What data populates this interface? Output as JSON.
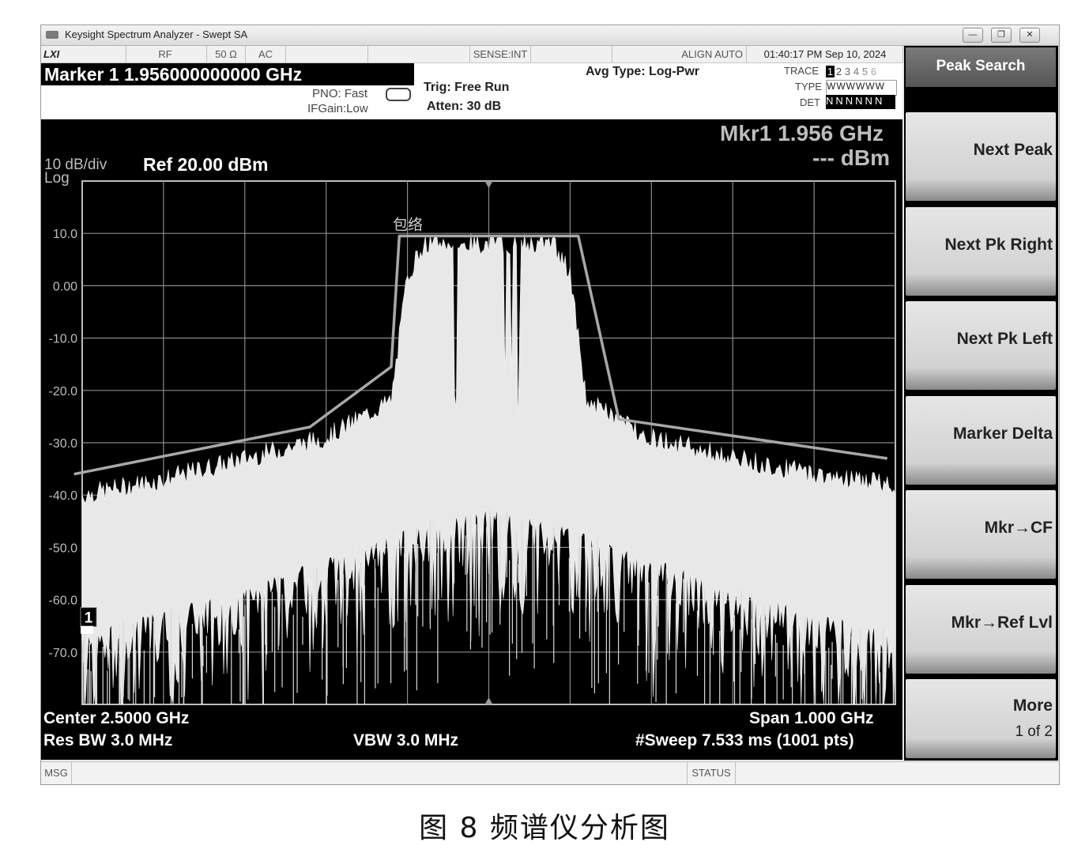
{
  "window": {
    "title": "Keysight Spectrum Analyzer - Swept SA"
  },
  "status_row": {
    "lxi": "LXI",
    "rf": "RF",
    "impedance": "50 Ω",
    "coupling": "AC",
    "sense": "SENSE:INT",
    "align": "ALIGN AUTO",
    "datetime": "01:40:17 PM Sep 10, 2024"
  },
  "header": {
    "marker": "Marker 1 1.956000000000 GHz",
    "pno": "PNO: Fast",
    "ifgain": "IFGain:Low",
    "trig": "Trig: Free Run",
    "atten": "Atten: 30 dB",
    "avg_type": "Avg Type: Log-Pwr",
    "trace_label": "TRACE",
    "type_label": "TYPE",
    "det_label": "DET",
    "trace_numbers": [
      "1",
      "2",
      "3",
      "4",
      "5",
      "6"
    ],
    "type_values": "WWWWWW",
    "det_values": "NNNNNN"
  },
  "screen": {
    "mkr_readout": "Mkr1 1.956 GHz",
    "mkr_value": "--- dBm",
    "scale": "10 dB/div",
    "log": "Log",
    "ref": "Ref 20.00 dBm",
    "center": "Center 2.5000 GHz",
    "res_bw": "Res BW 3.0 MHz",
    "vbw": "VBW 3.0 MHz",
    "span": "Span 1.000 GHz",
    "sweep": "#Sweep  7.533 ms (1001 pts)",
    "marker_num": "1",
    "envelope_label": "包络"
  },
  "softkeys": {
    "title": "Peak Search",
    "items": [
      {
        "label": "Next Peak"
      },
      {
        "label": "Next Pk Right"
      },
      {
        "label": "Next Pk Left"
      },
      {
        "label": "Marker Delta"
      },
      {
        "label": "Mkr→CF"
      },
      {
        "label": "Mkr→Ref Lvl"
      },
      {
        "label": "More",
        "sub": "1 of 2"
      }
    ]
  },
  "bottom": {
    "msg": "MSG",
    "status": "STATUS"
  },
  "caption": "图 8    频谱仪分析图",
  "chart_data": {
    "type": "line",
    "ylabel": "",
    "xlabel": "",
    "y_ticks": [
      "10.0",
      "0.00",
      "-10.0",
      "-20.0",
      "-30.0",
      "-40.0",
      "-50.0",
      "-60.0",
      "-70.0"
    ],
    "ylim": [
      -80,
      20
    ],
    "xlim_ghz": [
      2.0,
      3.0
    ],
    "grid": true,
    "series": [
      {
        "name": "包络",
        "x_ghz": [
          1.99,
          2.28,
          2.38,
          2.39,
          2.61,
          2.66,
          2.99
        ],
        "y_dbm": [
          -36,
          -27,
          -15.5,
          9.5,
          9.5,
          -25.5,
          -33
        ]
      },
      {
        "name": "",
        "x_ghz": [
          2.0,
          2.1,
          2.2,
          2.3,
          2.38,
          2.4,
          2.42,
          2.5,
          2.58,
          2.6,
          2.62,
          2.7,
          2.8,
          2.9,
          3.0
        ],
        "y_dbm": [
          -40,
          -37,
          -33,
          -29,
          -22,
          2,
          8,
          8,
          8,
          2,
          -22,
          -29,
          -33,
          -36,
          -38
        ]
      },
      {
        "name": "",
        "x_ghz": [
          2.0,
          2.1,
          2.2,
          2.3,
          2.4,
          2.5,
          2.6,
          2.7,
          2.8,
          2.9,
          3.0
        ],
        "y_dbm": [
          -66,
          -62,
          -57,
          -52,
          -46,
          -42,
          -46,
          -52,
          -57,
          -62,
          -66
        ]
      }
    ]
  }
}
